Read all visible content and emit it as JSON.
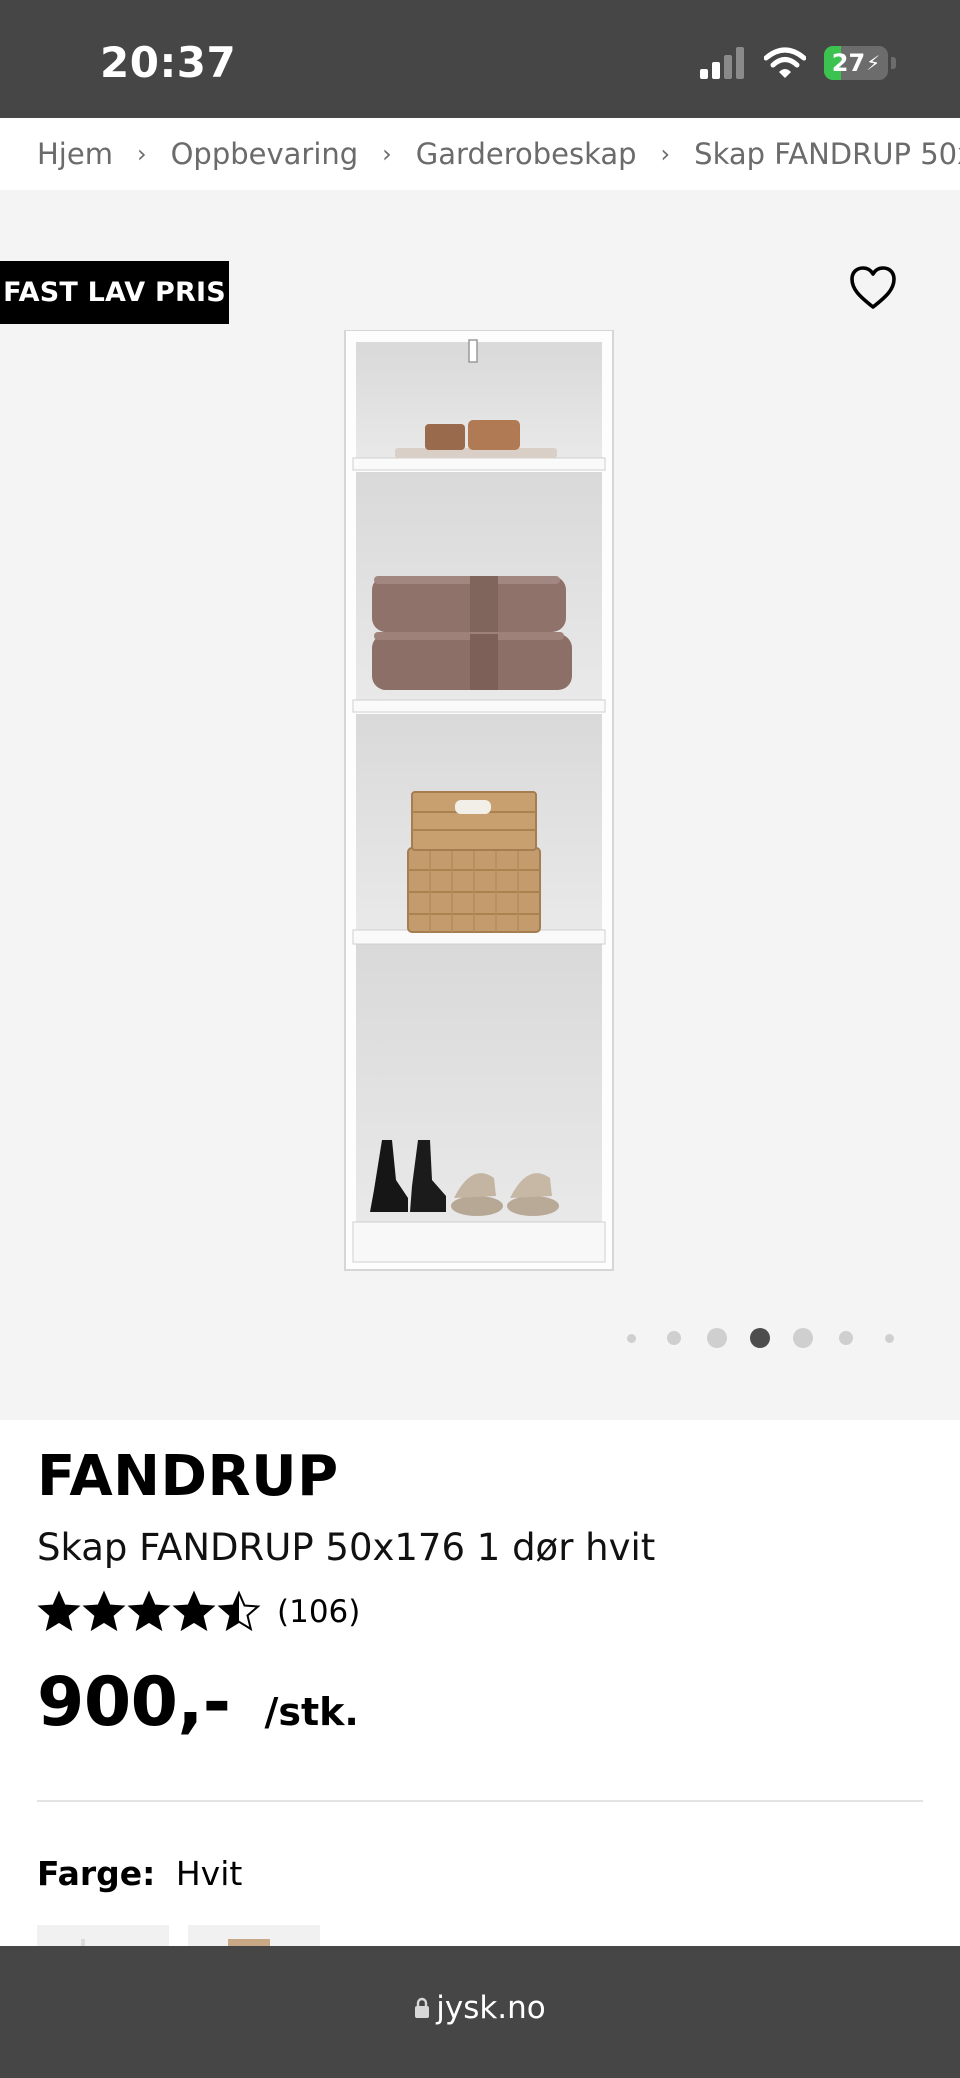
{
  "status_bar": {
    "time": "20:37",
    "battery": "27",
    "battery_level": 0.27
  },
  "breadcrumb": [
    "Hjem",
    "Oppbevaring",
    "Garderobeskap",
    "Skap FANDRUP 50x"
  ],
  "gallery": {
    "badge": "FAST LAV PRIS",
    "total_images": 7,
    "active_index": 3
  },
  "product": {
    "brand": "FANDRUP",
    "name": "Skap FANDRUP 50x176 1 dør hvit",
    "rating": 4.5,
    "review_count": "(106)",
    "price": "900,-",
    "unit": "/stk.",
    "color_label": "Farge:",
    "color_value": "Hvit"
  },
  "browser": {
    "url": "jysk.no"
  },
  "colors": {
    "status_bar": "#464646",
    "gallery_bg": "#f4f4f4",
    "badge_bg": "#000000",
    "battery_green": "#3bc24f"
  }
}
